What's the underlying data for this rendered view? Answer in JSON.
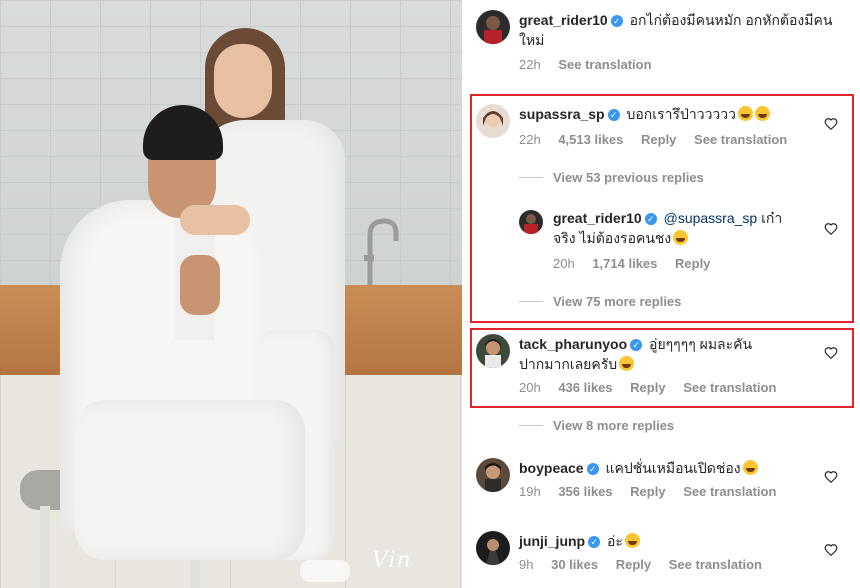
{
  "photo": {
    "watermark": "Vin"
  },
  "comments": [
    {
      "username": "great_rider10",
      "text": "อกไก่ต้องมีคนหมัก อกหักต้องมีคนใหม่",
      "text_line1": "อกไก่ต้องมีคนหมัก อกหักต้องมีคน",
      "text_line2": "ใหม่",
      "time": "22h",
      "see_translation": "See translation"
    },
    {
      "username": "supassra_sp",
      "text": "บอกเรารึป่าววววว",
      "time": "22h",
      "likes": "4,513 likes",
      "reply": "Reply",
      "see_translation": "See translation",
      "view_previous": "View 53 previous replies",
      "reply_item": {
        "username": "great_rider10",
        "mention": "@supassra_sp",
        "text_line1_rest": "เก๋า",
        "text_line2": "จริง ไม่ต้องรอคนชง",
        "time": "20h",
        "likes": "1,714 likes",
        "reply": "Reply"
      },
      "view_more": "View 75 more replies"
    },
    {
      "username": "tack_pharunyoo",
      "text_line1": "อู่ยๆๆๆๆ ผมละคัน",
      "text_line2": "ปากมากเลยครับ",
      "time": "20h",
      "likes": "436 likes",
      "reply": "Reply",
      "see_translation": "See translation",
      "view_more": "View 8 more replies"
    },
    {
      "username": "boypeace",
      "text": "แคปชั่นเหมือนเปิดช่อง",
      "time": "19h",
      "likes": "356 likes",
      "reply": "Reply",
      "see_translation": "See translation"
    },
    {
      "username": "junji_junp",
      "text": "อ่ะ",
      "time": "9h",
      "likes": "30 likes",
      "reply": "Reply",
      "see_translation": "See translation"
    }
  ],
  "colors": {
    "highlight_box": "#e0252c",
    "verified": "#3897f0",
    "meta": "#8e8e8e"
  }
}
